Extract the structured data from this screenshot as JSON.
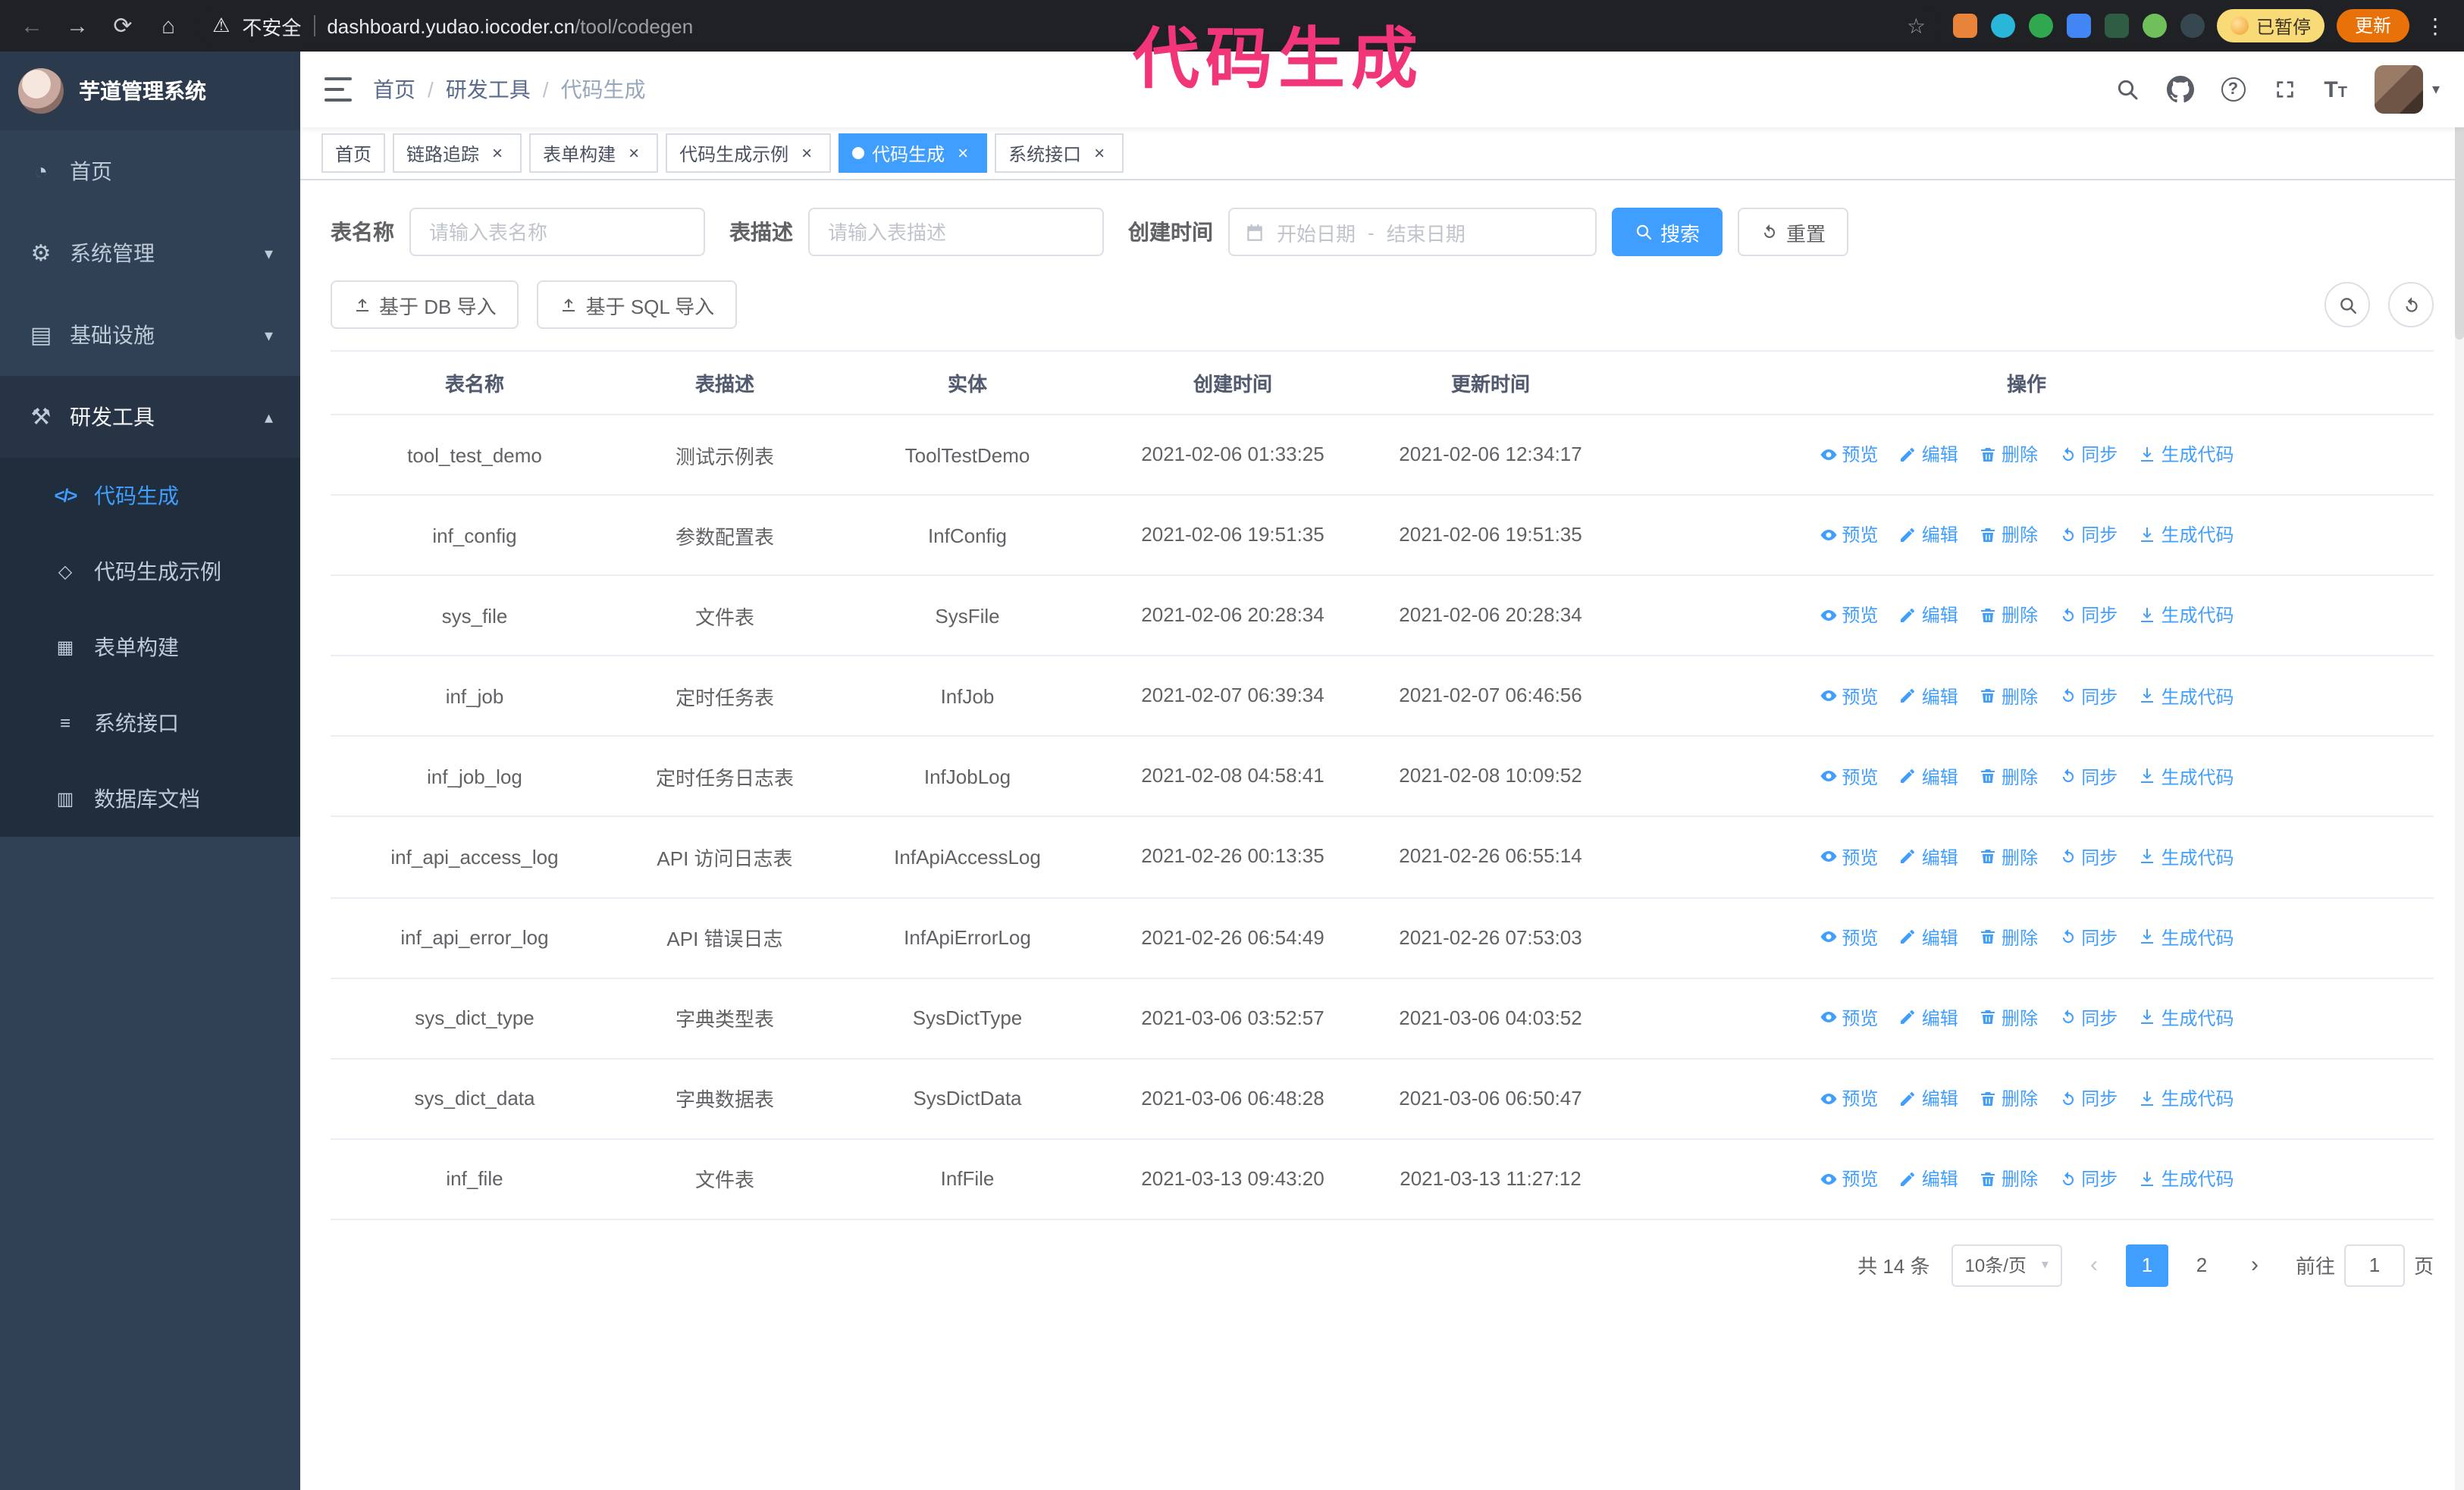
{
  "colors": {
    "accent": "#409eff",
    "sidebar_bg": "#304156",
    "submenu_bg": "#1f2d3d",
    "annotation_pink": "#f23578",
    "update_button_bg": "#e8710a",
    "paused_badge_bg": "#f8da77",
    "browser_bar_bg": "#202124"
  },
  "browser": {
    "security_label": "不安全",
    "url_domain": "dashboard.yudao.iocoder.cn",
    "url_path": "/tool/codegen",
    "paused_badge": "已暂停",
    "update_button": "更新"
  },
  "annotation": "代码生成",
  "sidebar": {
    "title": "芋道管理系统",
    "items": [
      {
        "label": "首页"
      },
      {
        "label": "系统管理"
      },
      {
        "label": "基础设施"
      },
      {
        "label": "研发工具"
      }
    ],
    "subitems": [
      {
        "label": "代码生成"
      },
      {
        "label": "代码生成示例"
      },
      {
        "label": "表单构建"
      },
      {
        "label": "系统接口"
      },
      {
        "label": "数据库文档"
      }
    ]
  },
  "breadcrumb": [
    "首页",
    "研发工具",
    "代码生成"
  ],
  "tags": [
    {
      "label": "首页"
    },
    {
      "label": "链路追踪"
    },
    {
      "label": "表单构建"
    },
    {
      "label": "代码生成示例"
    },
    {
      "label": "代码生成"
    },
    {
      "label": "系统接口"
    }
  ],
  "filters": {
    "table_name_label": "表名称",
    "table_name_placeholder": "请输入表名称",
    "table_desc_label": "表描述",
    "table_desc_placeholder": "请输入表描述",
    "create_time_label": "创建时间",
    "date_start_placeholder": "开始日期",
    "date_separator": "-",
    "date_end_placeholder": "结束日期",
    "search_button": "搜索",
    "reset_button": "重置"
  },
  "toolbar": {
    "import_db": "基于 DB 导入",
    "import_sql": "基于 SQL 导入"
  },
  "table": {
    "headers": [
      "表名称",
      "表描述",
      "实体",
      "创建时间",
      "更新时间",
      "操作"
    ],
    "action_labels": [
      "预览",
      "编辑",
      "删除",
      "同步",
      "生成代码"
    ],
    "rows": [
      {
        "name": "tool_test_demo",
        "desc": "测试示例表",
        "entity": "ToolTestDemo",
        "create_time": "2021-02-06 01:33:25",
        "update_time": "2021-02-06 12:34:17"
      },
      {
        "name": "inf_config",
        "desc": "参数配置表",
        "entity": "InfConfig",
        "create_time": "2021-02-06 19:51:35",
        "update_time": "2021-02-06 19:51:35"
      },
      {
        "name": "sys_file",
        "desc": "文件表",
        "entity": "SysFile",
        "create_time": "2021-02-06 20:28:34",
        "update_time": "2021-02-06 20:28:34"
      },
      {
        "name": "inf_job",
        "desc": "定时任务表",
        "entity": "InfJob",
        "create_time": "2021-02-07 06:39:34",
        "update_time": "2021-02-07 06:46:56"
      },
      {
        "name": "inf_job_log",
        "desc": "定时任务日志表",
        "entity": "InfJobLog",
        "create_time": "2021-02-08 04:58:41",
        "update_time": "2021-02-08 10:09:52"
      },
      {
        "name": "inf_api_access_log",
        "desc": "API 访问日志表",
        "entity": "InfApiAccessLog",
        "create_time": "2021-02-26 00:13:35",
        "update_time": "2021-02-26 06:55:14"
      },
      {
        "name": "inf_api_error_log",
        "desc": "API 错误日志",
        "entity": "InfApiErrorLog",
        "create_time": "2021-02-26 06:54:49",
        "update_time": "2021-02-26 07:53:03"
      },
      {
        "name": "sys_dict_type",
        "desc": "字典类型表",
        "entity": "SysDictType",
        "create_time": "2021-03-06 03:52:57",
        "update_time": "2021-03-06 04:03:52"
      },
      {
        "name": "sys_dict_data",
        "desc": "字典数据表",
        "entity": "SysDictData",
        "create_time": "2021-03-06 06:48:28",
        "update_time": "2021-03-06 06:50:47"
      },
      {
        "name": "inf_file",
        "desc": "文件表",
        "entity": "InfFile",
        "create_time": "2021-03-13 09:43:20",
        "update_time": "2021-03-13 11:27:12"
      }
    ]
  },
  "pagination": {
    "total": "共 14 条",
    "page_size": "10条/页",
    "prev": "‹",
    "next": "›",
    "pages": [
      "1",
      "2"
    ],
    "active_page": "1",
    "goto_label": "前往",
    "goto_value": "1",
    "goto_unit": "页"
  }
}
